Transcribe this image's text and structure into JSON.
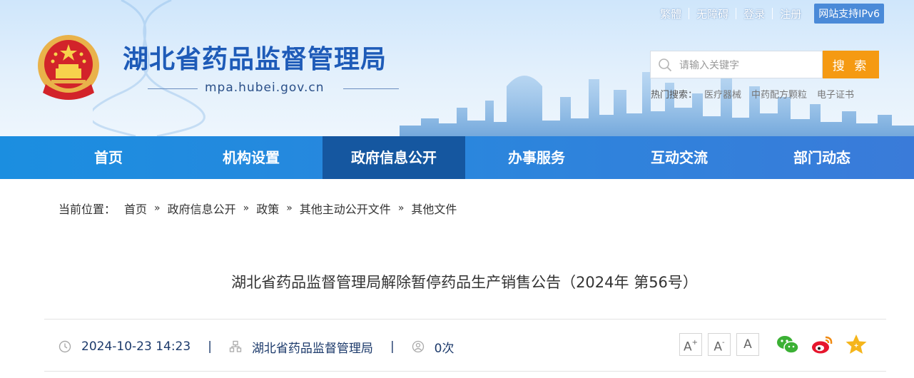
{
  "header": {
    "site_title": "湖北省药品监督管理局",
    "domain": "mpa.hubei.gov.cn",
    "top_links": [
      "繁體",
      "无障碍",
      "登录",
      "注册"
    ],
    "ipv6_badge": "网站支持IPv6",
    "search": {
      "placeholder": "请输入关键字",
      "button_label": "搜 索"
    },
    "hot_search": {
      "label": "热门搜索：",
      "items": [
        "医疗器械",
        "中药配方颗粒",
        "电子证书"
      ]
    }
  },
  "nav": {
    "items": [
      "首页",
      "机构设置",
      "政府信息公开",
      "办事服务",
      "互动交流",
      "部门动态"
    ],
    "active_index": 2
  },
  "breadcrumb": {
    "label": "当前位置：",
    "items": [
      "首页",
      "政府信息公开",
      "政策",
      "其他主动公开文件",
      "其他文件"
    ],
    "separator": "»"
  },
  "article": {
    "title": "湖北省药品监督管理局解除暂停药品生产销售公告（2024年 第56号）",
    "date": "2024-10-23 14:23",
    "source": "湖北省药品监督管理局",
    "views": "0次",
    "meta_separator": "|"
  },
  "font_size": {
    "large": "A",
    "medium": "A",
    "normal": "A"
  },
  "colors": {
    "nav_bg": "#2a86dd",
    "nav_active": "#1557a0",
    "title_blue": "#1e5bb8",
    "search_button": "#f59a12"
  }
}
